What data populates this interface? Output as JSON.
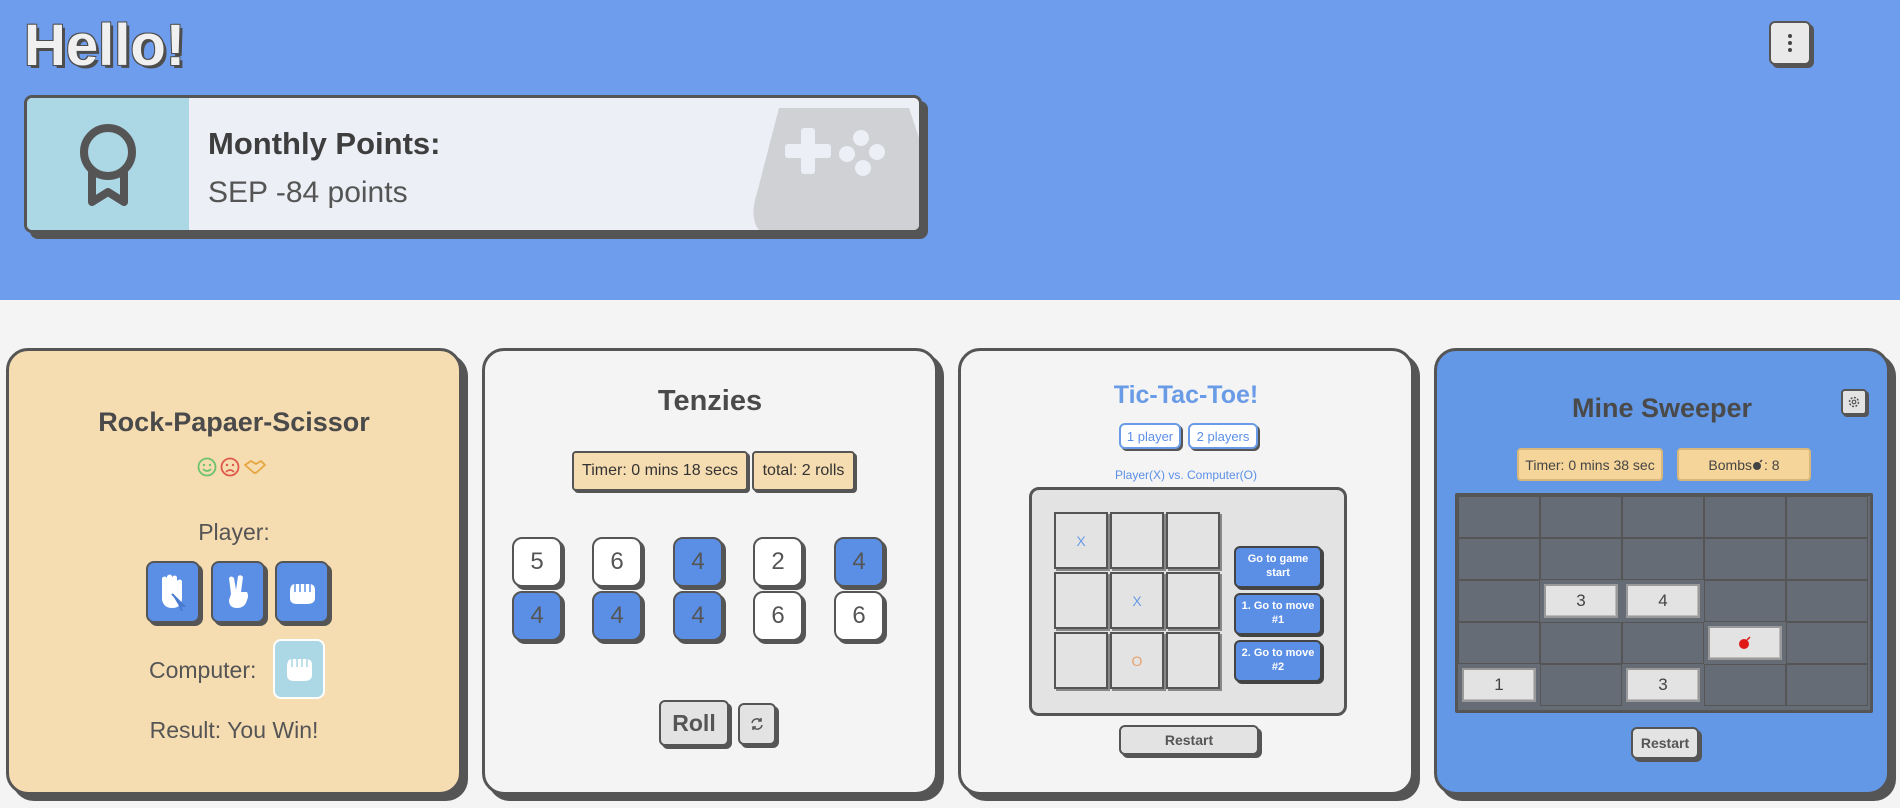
{
  "header": {
    "greeting": "Hello!",
    "menu_icon": "vertical-dots-icon"
  },
  "points": {
    "label": "Monthly Points:",
    "value": "SEP -84 points",
    "badge_icon": "award-ribbon-icon",
    "background_icon": "gamepad-icon"
  },
  "rps": {
    "title": "Rock-Papaer-Scissor",
    "status_icons": [
      "smile-face-icon",
      "frown-face-icon",
      "handshake-icon"
    ],
    "player_label": "Player:",
    "player_options": [
      "rock-hand-icon",
      "scissor-hand-icon",
      "paper-hand-icon"
    ],
    "computer_label": "Computer:",
    "computer_choice": "fist-hand-icon",
    "result": "Result: You Win!"
  },
  "tenzies": {
    "title": "Tenzies",
    "timer": "Timer:  0 mins 18 secs",
    "total": "total: 2 rolls",
    "dice": [
      {
        "value": "5",
        "held": false
      },
      {
        "value": "6",
        "held": false
      },
      {
        "value": "4",
        "held": true
      },
      {
        "value": "2",
        "held": false
      },
      {
        "value": "4",
        "held": true
      },
      {
        "value": "4",
        "held": true
      },
      {
        "value": "4",
        "held": true
      },
      {
        "value": "4",
        "held": true
      },
      {
        "value": "6",
        "held": false
      },
      {
        "value": "6",
        "held": false
      }
    ],
    "roll_label": "Roll",
    "reset_icon": "refresh-icon"
  },
  "tictactoe": {
    "title": "Tic-Tac-Toe!",
    "mode_one": "1 player",
    "mode_two": "2 players",
    "subtitle": "Player(X) vs. Computer(O)",
    "board": [
      "X",
      "",
      "",
      "",
      "X",
      "",
      "",
      "O",
      ""
    ],
    "history": [
      "Go to game start",
      "1. Go to move #1",
      "2. Go to move #2"
    ],
    "restart_label": "Restart"
  },
  "minesweeper": {
    "title": "Mine Sweeper",
    "settings_icon": "gear-icon",
    "timer": "Timer: 0 mins 38 sec",
    "bombs_prefix": "Bombs",
    "bombs_count": ": 8",
    "bomb_icon": "bomb-icon",
    "grid": [
      [
        "",
        "",
        "",
        "",
        ""
      ],
      [
        "",
        "",
        "",
        "",
        ""
      ],
      [
        "",
        "3",
        "4",
        "",
        ""
      ],
      [
        "",
        "",
        "",
        "bomb",
        ""
      ],
      [
        "1",
        "",
        "3",
        "",
        ""
      ]
    ],
    "restart_label": "Restart"
  },
  "colors": {
    "hero_blue": "#6f9ded",
    "accent_blue": "#5b8fe6",
    "peach": "#f6dcb1",
    "tile_gray": "#e3e3e3",
    "mine_dark": "#666c76",
    "light_blue": "#acd7e5"
  }
}
